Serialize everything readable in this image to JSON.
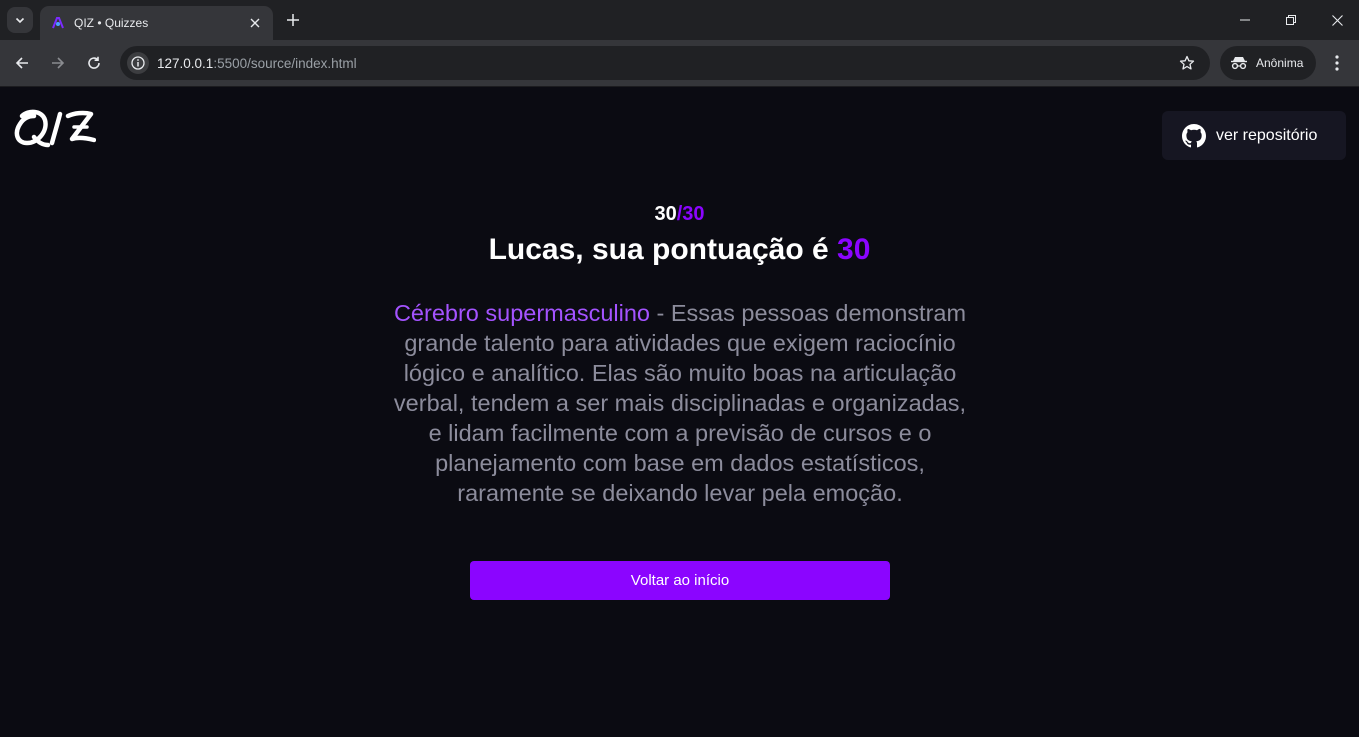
{
  "browser": {
    "tab_title": "QIZ • Quizzes",
    "url_host": "127.0.0.1",
    "url_rest": ":5500/source/index.html",
    "profile_label": "Anônima"
  },
  "page": {
    "logo_text": "QIZ",
    "repo_button_label": "ver repositório",
    "score": {
      "correct": "30",
      "separator_total": "/30"
    },
    "headline": {
      "prefix": "Lucas, sua pontuação é ",
      "value": "30"
    },
    "result": {
      "title": "Cérebro supermasculino",
      "description": " - Essas pessoas demonstram grande talento para atividades que exigem raciocínio lógico e analítico. Elas são muito boas na articulação verbal, tendem a ser mais disciplinadas e organizadas, e lidam facilmente com a previsão de cursos e o planejamento com base em dados estatísticos, raramente se deixando levar pela emoção."
    },
    "back_button_label": "Voltar ao início"
  },
  "colors": {
    "accent": "#8b05ff",
    "accent_light": "#a453ff",
    "background": "#0b0b12",
    "muted_text": "#8c8c9c"
  }
}
